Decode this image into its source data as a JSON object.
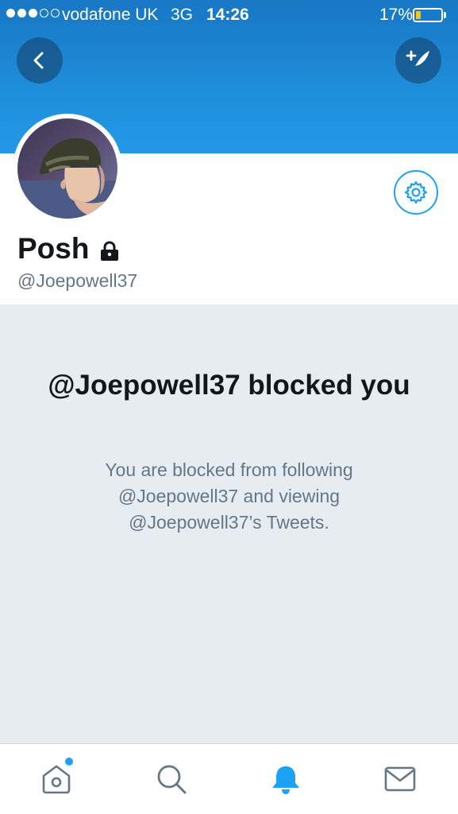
{
  "status_bar": {
    "carrier": "vodafone UK",
    "network": "3G",
    "time": "14:26",
    "battery_percent": "17%",
    "signal_bars_filled": 3,
    "signal_bars_total": 5
  },
  "header": {
    "back_icon": "chevron-left-icon",
    "compose_icon": "compose-tweet-icon"
  },
  "profile": {
    "display_name": "Posh",
    "protected_icon": "lock-icon",
    "handle": "@Joepowell37",
    "settings_icon": "gear-icon"
  },
  "blocked": {
    "title": "@Joepowell37 blocked you",
    "message": "You are blocked from following @Joepowell37 and viewing @Joepowell37’s Tweets."
  },
  "tabbar": {
    "tabs": [
      {
        "name": "home",
        "icon": "home-icon",
        "active": false,
        "badge": true
      },
      {
        "name": "search",
        "icon": "search-icon",
        "active": false,
        "badge": false
      },
      {
        "name": "notifications",
        "icon": "bell-icon",
        "active": true,
        "badge": false
      },
      {
        "name": "messages",
        "icon": "envelope-icon",
        "active": false,
        "badge": false
      }
    ]
  },
  "colors": {
    "brand_blue": "#1da1f2",
    "header_blue": "#1f8fdb",
    "panel_gray": "#e6ecf0",
    "text_dark": "#14171a",
    "text_muted": "#657786"
  }
}
